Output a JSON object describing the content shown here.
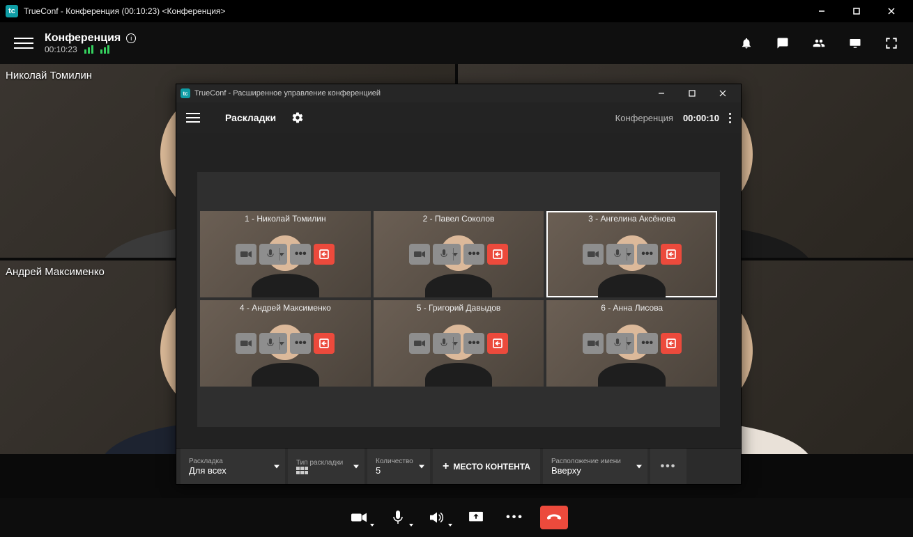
{
  "outer": {
    "title": "TrueConf - Конференция (00:10:23) <Конференция>"
  },
  "header": {
    "title": "Конференция",
    "timer": "00:10:23"
  },
  "participants_back": [
    {
      "name": "Николай Томилин"
    },
    {
      "name": "Андрей Максименко"
    },
    {
      "name": ""
    },
    {
      "name": ""
    }
  ],
  "mgr": {
    "title": "TrueConf - Расширенное управление конференцией",
    "section": "Раскладки",
    "timer_label": "Конференция",
    "timer": "00:00:10",
    "cells": [
      "1 - Николай Томилин",
      "2 - Павел Соколов",
      "3 - Ангелина Аксёнова",
      "4 - Андрей Максименко",
      "5 - Григорий Давыдов",
      "6 - Анна Лисова"
    ],
    "toolbar": {
      "layout_label": "Раскладка",
      "layout_value": "Для всех",
      "type_label": "Тип раскладки",
      "count_label": "Количество",
      "count_value": "5",
      "content_btn": "МЕСТО КОНТЕНТА",
      "name_pos_label": "Расположение имени",
      "name_pos_value": "Вверху"
    }
  }
}
